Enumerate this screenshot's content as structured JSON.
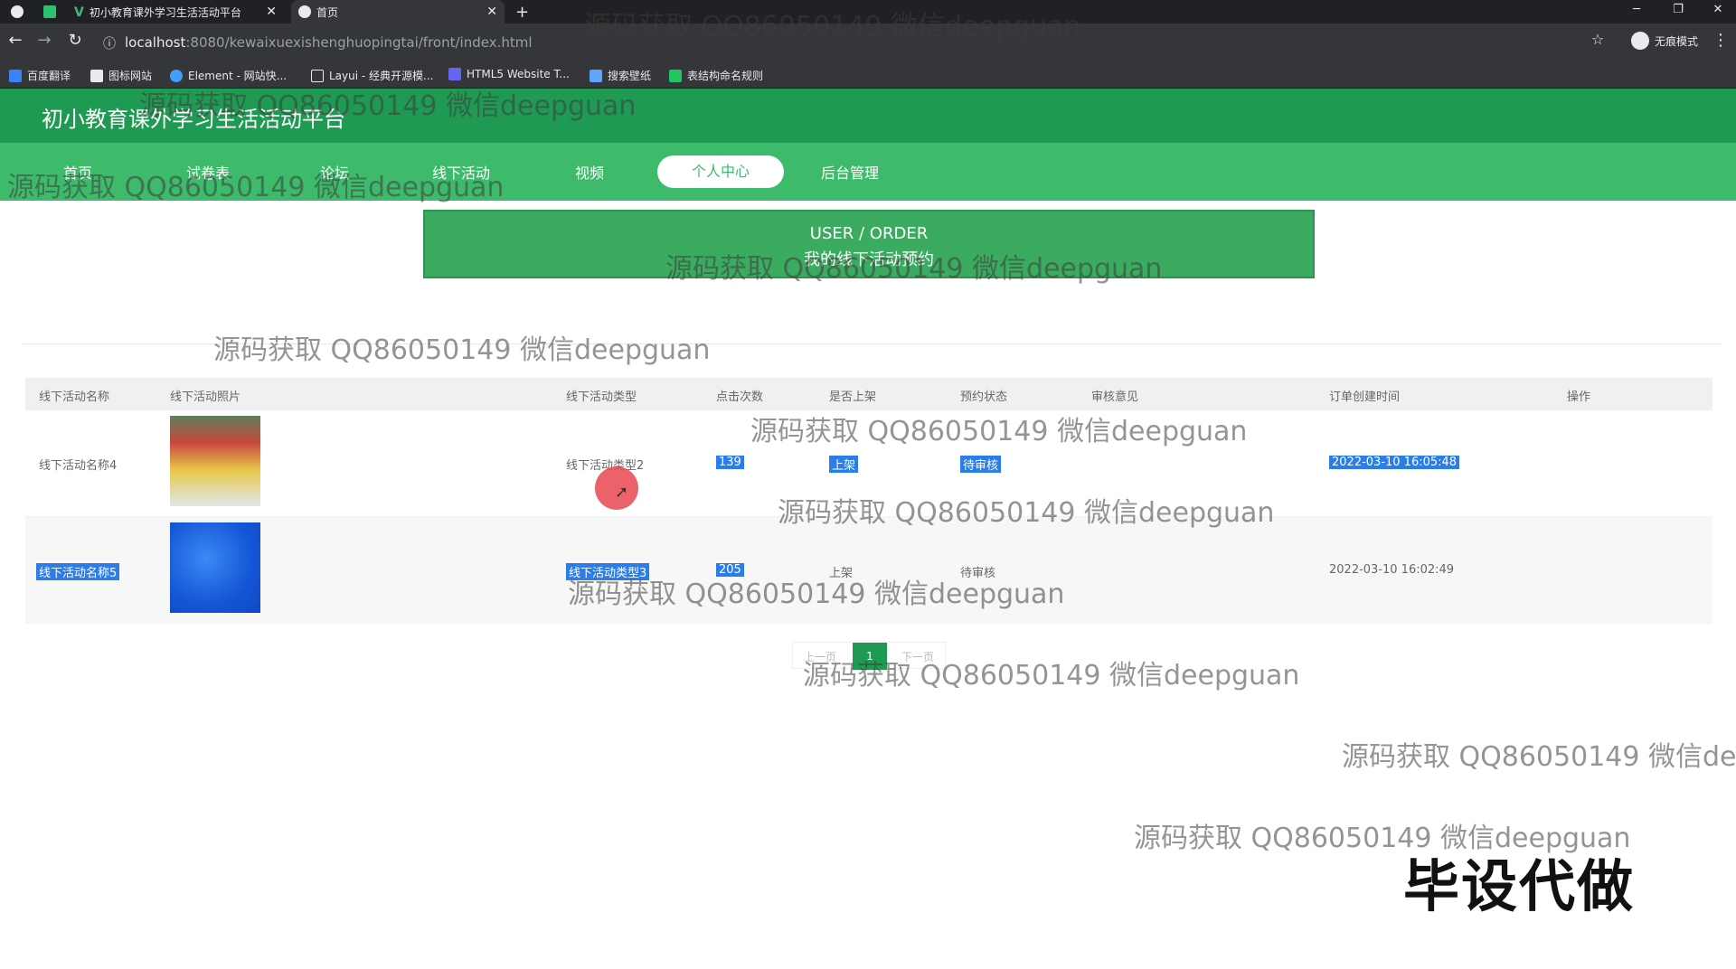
{
  "browser": {
    "tabs": [
      {
        "label": "初小教育课外学习生活活动平台",
        "active": false
      },
      {
        "label": "首页",
        "active": true
      }
    ],
    "new_tab": "+",
    "window": {
      "minimize": "─",
      "restore": "❐",
      "close": "✕"
    },
    "url_host": "localhost",
    "url_path": ":8080/kewaixuexishenghuopingtai/front/index.html",
    "profile_label": "无痕模式",
    "bookmarks": [
      "百度翻译",
      "图标网站",
      "Element - 网站快...",
      "Layui - 经典开源模...",
      "HTML5 Website T...",
      "搜索壁纸",
      "表结构命名规则"
    ]
  },
  "site": {
    "title": "初小教育课外学习生活活动平台",
    "nav": [
      "首页",
      "试卷表",
      "论坛",
      "线下活动",
      "视频",
      "个人中心",
      "后台管理"
    ],
    "active_nav": "个人中心"
  },
  "banner": {
    "en": "USER / ORDER",
    "cn": "我的线下活动预约"
  },
  "table": {
    "headers": [
      "线下活动名称",
      "线下活动照片",
      "线下活动类型",
      "点击次数",
      "是否上架",
      "预约状态",
      "审核意见",
      "订单创建时间",
      "操作"
    ],
    "rows": [
      {
        "name": "线下活动名称4",
        "type": "线下活动类型2",
        "clicks": "139",
        "listed": "上架",
        "status": "待审核",
        "opinion": "",
        "created": "2022-03-10 16:05:48"
      },
      {
        "name": "线下活动名称5",
        "type": "线下活动类型3",
        "clicks": "205",
        "listed": "上架",
        "status": "待审核",
        "opinion": "",
        "created": "2022-03-10 16:02:49"
      }
    ]
  },
  "pager": {
    "prev": "上一页",
    "current": "1",
    "next": "下一页"
  },
  "watermark": "源码获取 QQ86050149 微信deepguan",
  "stamp": "毕设代做"
}
